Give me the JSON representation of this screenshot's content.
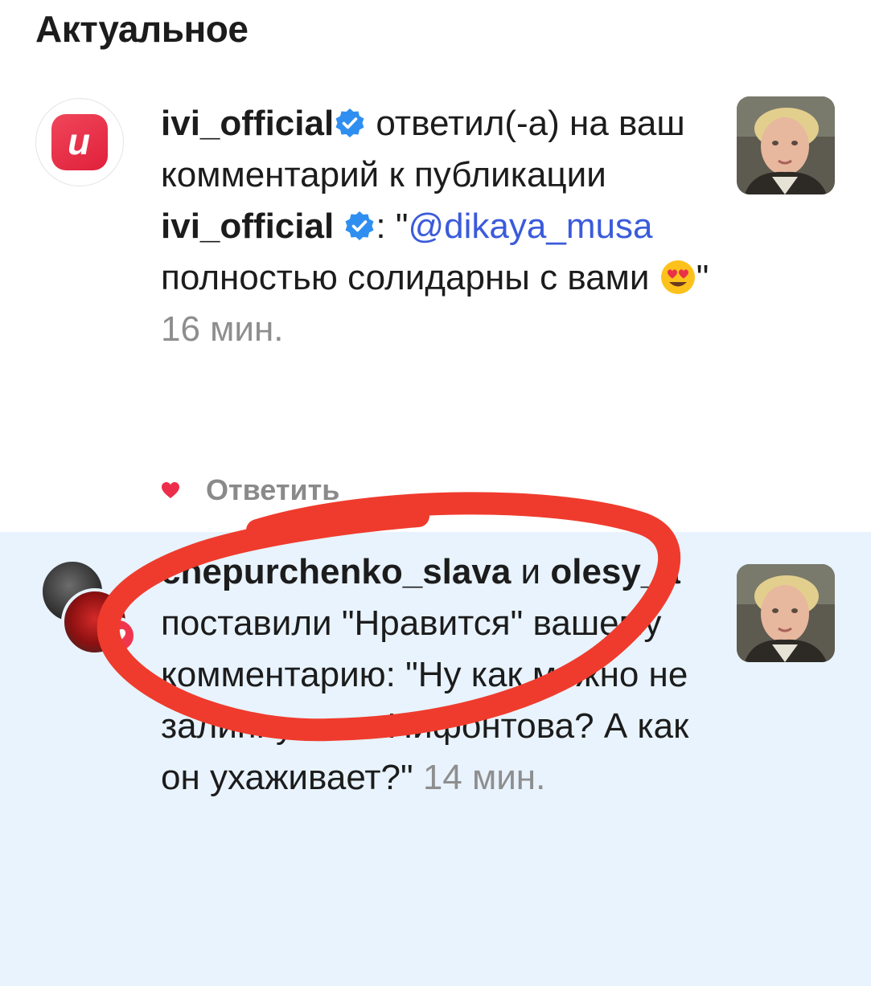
{
  "section": {
    "title": "Актуальное"
  },
  "notifications": [
    {
      "username": "ivi_official",
      "action": " ответил(-а) на ваш комментарий к публикации ",
      "post_owner": "ivi_official",
      "quote_prefix": ": \"",
      "mention": "@dikaya_musa",
      "comment": " полностью солидарны с вами ",
      "emoji": "smiling-face-with-heart-eyes",
      "quote_suffix": "\" ",
      "time": "16 мин.",
      "reply_label": "Ответить"
    },
    {
      "user_1": "chepurchenko_slava",
      "and": " и ",
      "user_2": "olesy_a",
      "action": " поставили \"Нравится\" вашему комментарию: ",
      "comment": "\"Ну как можно не залипнуть на Нифонтова? А как он ухаживает?\" ",
      "time": "14 мин."
    }
  ],
  "annotation": {
    "color": "#ef3b2d"
  }
}
